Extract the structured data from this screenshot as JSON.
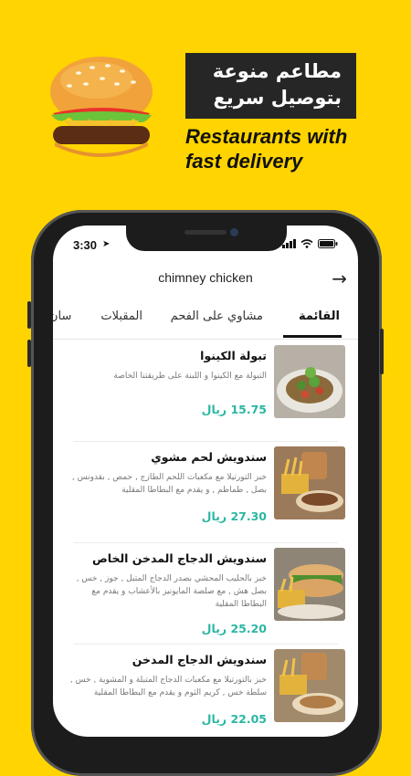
{
  "promo": {
    "arabic_line1": "مطاعم منوعة",
    "arabic_line2": "بتوصيل سريع",
    "english_line1": "Restaurants with",
    "english_line2": "fast delivery",
    "image": "burger-emoji"
  },
  "status_bar": {
    "time": "3:30",
    "location_icon": "location-arrow-icon",
    "signal_icon": "cellular-signal-icon",
    "wifi_icon": "wifi-icon",
    "battery_icon": "battery-icon"
  },
  "header": {
    "restaurant_name": "chimney chicken",
    "back_icon": "arrow-right-icon"
  },
  "tabs": [
    {
      "label": "القائمة",
      "active": true
    },
    {
      "label": "مشاوي على الفحم",
      "active": false
    },
    {
      "label": "المقبلات",
      "active": false
    },
    {
      "label": "سان",
      "active": false
    }
  ],
  "menu_items": [
    {
      "name": "تبولة الكينوا",
      "description": "التبولة مع الكينوا و اللبنة على طريقتنا الخاصة",
      "price": "15.75 ريال"
    },
    {
      "name": "سندويش لحم مشوي",
      "description": "خبز التورتيلا مع مكعبات اللحم الطازج , حمص , بقدونس , بصل , طماطم , و يقدم مع البطاطا المقلية",
      "price": "27.30 ريال"
    },
    {
      "name": "سندويش الدجاج المدخن الخاص",
      "description": "خبز بالحليب المحشي بصدر الدجاج المتبل , جوز , خس , بصل هش , مع صلصة المايونيز بالأعشاب و يقدم مع البطاطا المقلية",
      "price": "25.20 ريال"
    },
    {
      "name": "سندويش الدجاج المدخن",
      "description": "خبز بالتورتيلا مع مكعبات الدجاج المتبلة و المشوية , خس , سلطة خس , كريم الثوم و يقدم مع البطاطا المقلية",
      "price": "22.05 ريال"
    }
  ],
  "colors": {
    "background": "#FFD400",
    "banner": "#262626",
    "price": "#2bb7a2"
  }
}
